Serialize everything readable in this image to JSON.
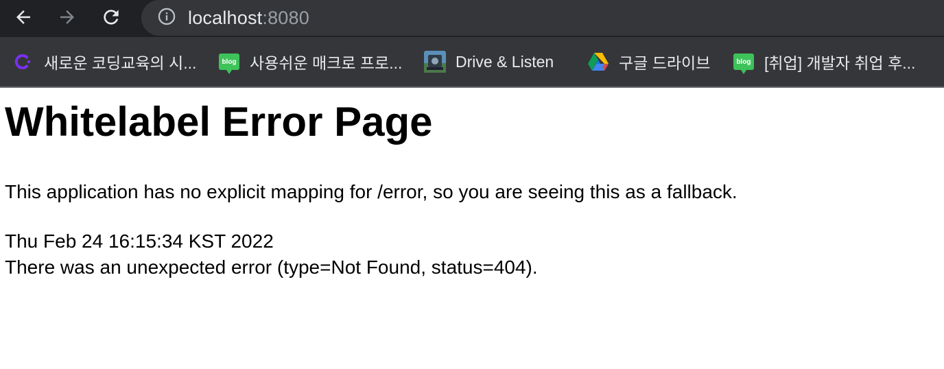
{
  "browser": {
    "back_icon": "arrow-left-icon",
    "forward_icon": "arrow-right-icon",
    "reload_icon": "reload-icon",
    "site_info_icon": "info-icon",
    "url_host": "localhost",
    "url_port": ":8080"
  },
  "bookmarks": [
    {
      "icon": "coding-school-icon",
      "label": "새로운 코딩교육의 시..."
    },
    {
      "icon": "blog-icon",
      "icon_text": "blog",
      "label": "사용쉬운 매크로 프로..."
    },
    {
      "icon": "drive-listen-icon",
      "label": "Drive & Listen"
    },
    {
      "icon": "google-drive-icon",
      "label": "구글 드라이브"
    },
    {
      "icon": "blog-icon",
      "icon_text": "blog",
      "label": "[취업] 개발자 취업 후..."
    }
  ],
  "page": {
    "title": "Whitelabel Error Page",
    "description": "This application has no explicit mapping for /error, so you are seeing this as a fallback.",
    "timestamp": "Thu Feb 24 16:15:34 KST 2022",
    "error_message": "There was an unexpected error (type=Not Found, status=404)."
  },
  "colors": {
    "toolbar_bg": "#202124",
    "omnibox_bg": "#35363a",
    "bookmarks_bg": "#35363a",
    "blog_green": "#3ec25a"
  }
}
